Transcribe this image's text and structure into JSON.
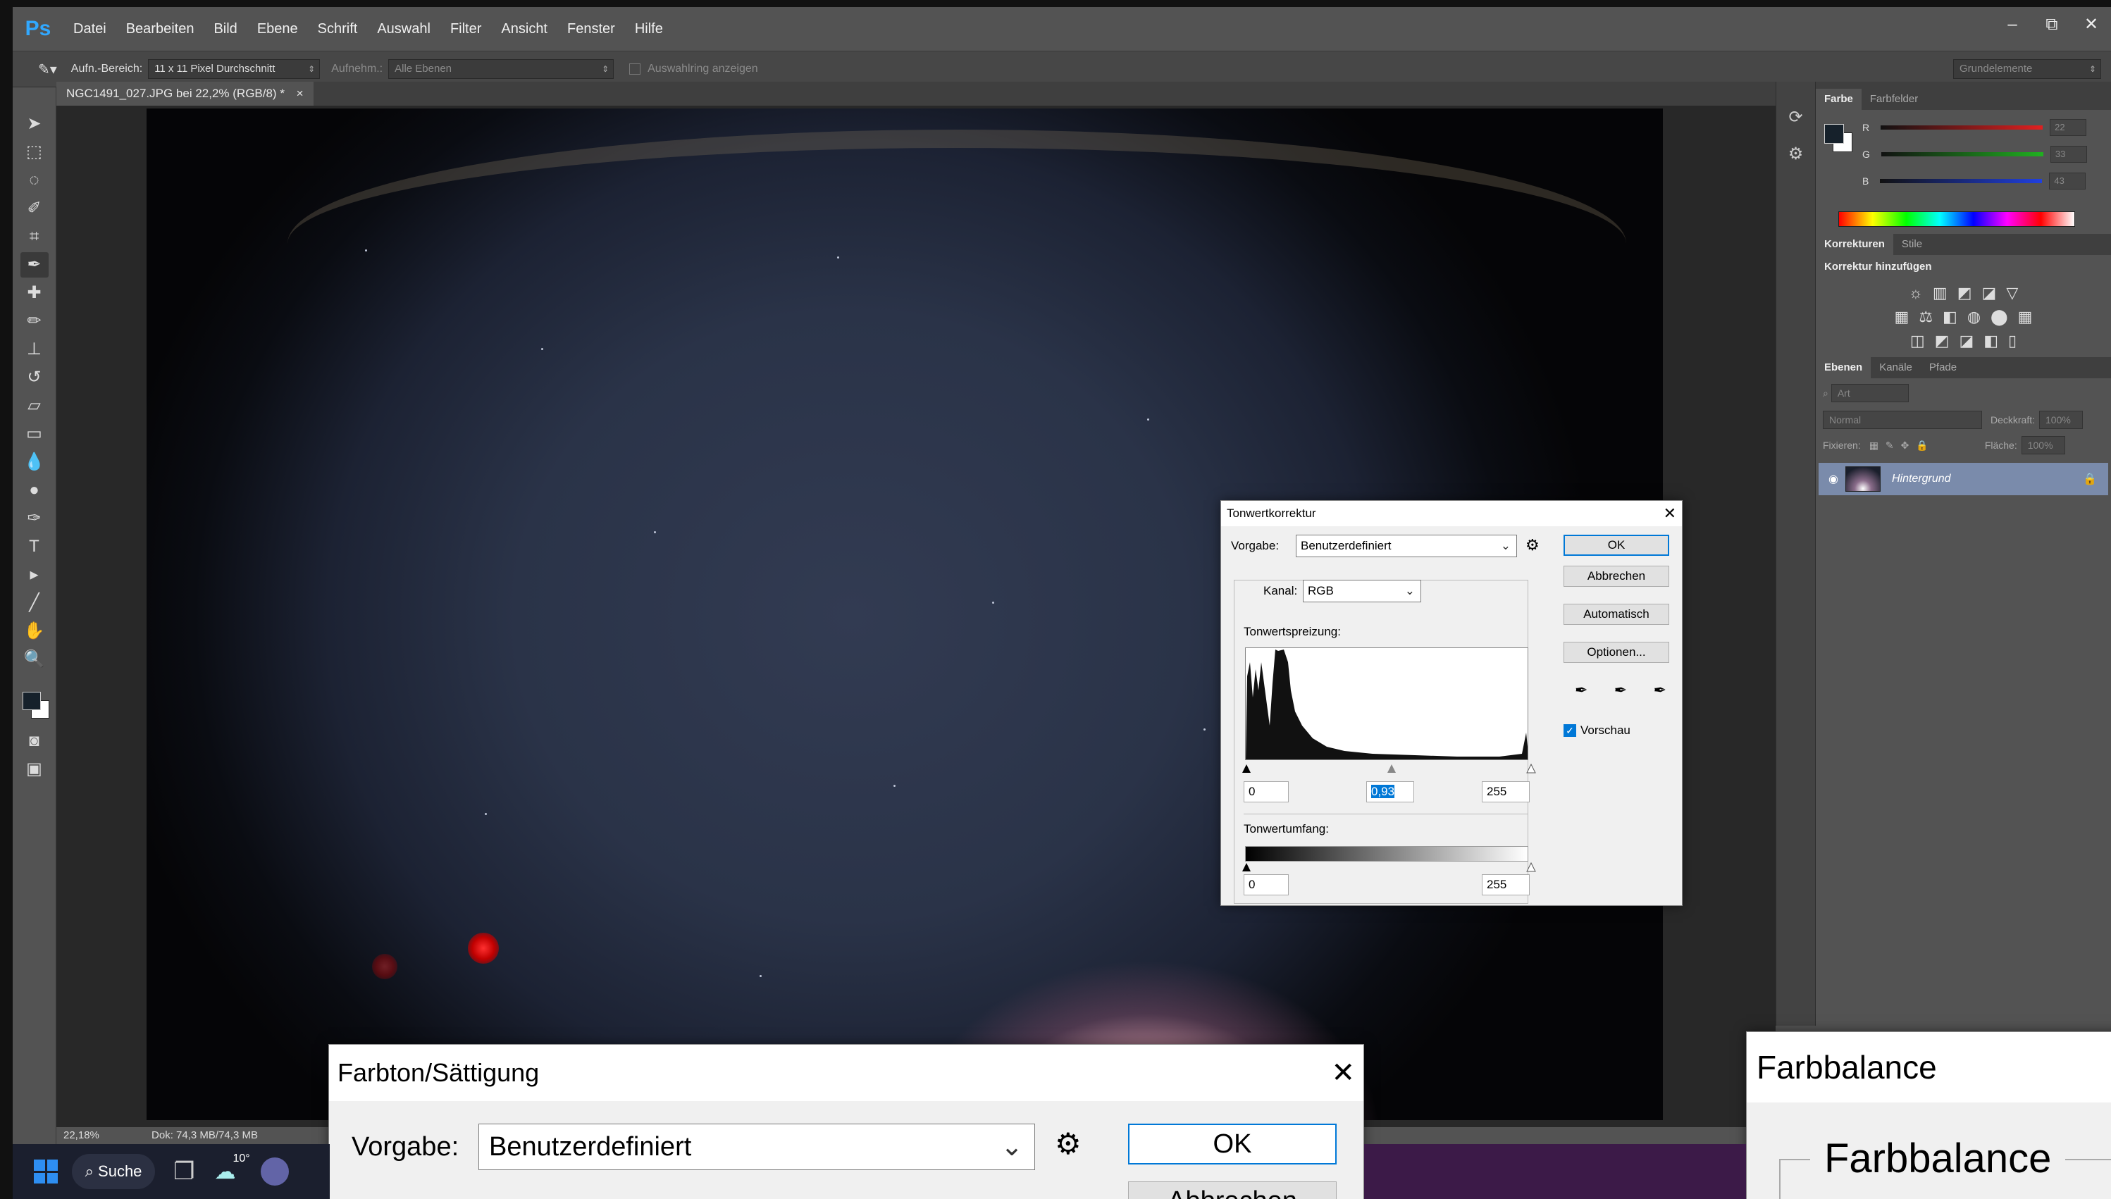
{
  "app": {
    "logo": "Ps",
    "menu": [
      "Datei",
      "Bearbeiten",
      "Bild",
      "Ebene",
      "Schrift",
      "Auswahl",
      "Filter",
      "Ansicht",
      "Fenster",
      "Hilfe"
    ],
    "window_controls": [
      "–",
      "⧉",
      "✕"
    ]
  },
  "options_bar": {
    "sample_label": "Aufn.-Bereich:",
    "sample_value": "11 x 11 Pixel Durchschnitt",
    "sample_layers_label": "Aufnehm.:",
    "sample_layers_value": "Alle Ebenen",
    "show_ring_label": "Auswahlring anzeigen",
    "workspace": "Grundelemente"
  },
  "document": {
    "tab_title": "NGC1491_027.JPG bei 22,2% (RGB/8) *",
    "tab_close": "×",
    "zoom": "22,18%",
    "doc_size": "Dok: 74,3 MB/74,3 MB"
  },
  "color_panel": {
    "tabs": [
      "Farbe",
      "Farbfelder"
    ],
    "channels": [
      {
        "label": "R",
        "value": "22",
        "color": "#e02020"
      },
      {
        "label": "G",
        "value": "33",
        "color": "#20b020"
      },
      {
        "label": "B",
        "value": "43",
        "color": "#2040e0"
      }
    ]
  },
  "adjustments_panel": {
    "tabs": [
      "Korrekturen",
      "Stile"
    ],
    "title": "Korrektur hinzufügen",
    "icons_row1": [
      "☼",
      "▥",
      "◩",
      "◪",
      "▽"
    ],
    "icons_row2": [
      "▦",
      "⚖",
      "◧",
      "◍",
      "⬤",
      "▦"
    ],
    "icons_row3": [
      "◫",
      "◩",
      "◪",
      "◧",
      "▯"
    ]
  },
  "layers_panel": {
    "tabs": [
      "Ebenen",
      "Kanäle",
      "Pfade"
    ],
    "filter_placeholder": "Art",
    "blend_mode": "Normal",
    "opacity_label": "Deckkraft:",
    "opacity_value": "100%",
    "lock_label": "Fixieren:",
    "fill_label": "Fläche:",
    "fill_value": "100%",
    "layer_name": "Hintergrund"
  },
  "levels_dialog": {
    "title": "Tonwertkorrektur",
    "close": "✕",
    "preset_label": "Vorgabe:",
    "preset_value": "Benutzerdefiniert",
    "channel_label": "Kanal:",
    "channel_value": "RGB",
    "input_levels_label": "Tonwertspreizung:",
    "input_black": "0",
    "input_gamma": "0,93",
    "input_white": "255",
    "output_levels_label": "Tonwertumfang:",
    "output_black": "0",
    "output_white": "255",
    "buttons": {
      "ok": "OK",
      "cancel": "Abbrechen",
      "auto": "Automatisch",
      "options": "Optionen..."
    },
    "preview_label": "Vorschau",
    "preview_checked": true
  },
  "hue_dialog": {
    "title": "Farbton/Sättigung",
    "close": "✕",
    "preset_label": "Vorgabe:",
    "preset_value": "Benutzerdefiniert",
    "ok": "OK",
    "cancel": "Abbrechen"
  },
  "balance_dialog": {
    "title": "Farbbalance",
    "group_label": "Farbbalance"
  },
  "taskbar": {
    "search_label": "Suche",
    "weather": "10°"
  }
}
